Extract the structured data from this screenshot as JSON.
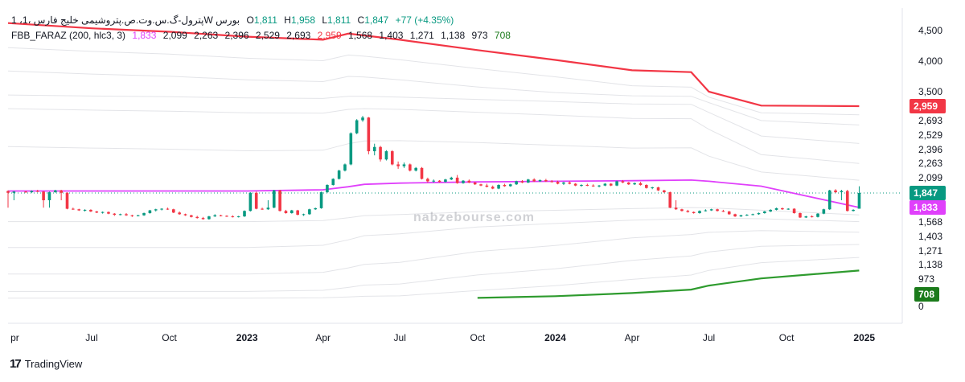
{
  "legend": {
    "title": "پترول-گ.س.وت.ص.پتروشیمی خلیج فارس، 1W، بورس",
    "title_display": "1 ،پترول-گ.س.وت.ص.پتروشیمی خلیج فارس ،1W بورس",
    "o_label": "O",
    "o": "1,811",
    "h_label": "H",
    "h": "1,958",
    "l_label": "L",
    "l": "1,811",
    "c_label": "C",
    "c": "1,847",
    "change": "+77 (+4.35%)",
    "indicator": "FBB_FARAZ (200, hlc3, 3)",
    "ind_values": [
      "1,833",
      "2,099",
      "2,263",
      "2,396",
      "2,529",
      "2,693",
      "2,959",
      "1,568",
      "1,403",
      "1,271",
      "1,138",
      "973",
      "708"
    ]
  },
  "branding": {
    "logo": "TradingView",
    "watermark": "nabzebourse.com"
  },
  "chart_data": {
    "type": "candlestick",
    "interval": "1W",
    "x_axis": {
      "tick_labels": [
        "pr",
        "Jul",
        "Oct",
        "2023",
        "Apr",
        "Jul",
        "Oct",
        "2024",
        "Apr",
        "Jul",
        "Oct",
        "2025"
      ],
      "tick_dates": [
        "2022-04-01",
        "2022-07-01",
        "2022-10-01",
        "2023-01-01",
        "2023-04-01",
        "2023-07-01",
        "2023-10-01",
        "2024-01-01",
        "2024-04-01",
        "2024-07-01",
        "2024-10-01",
        "2025-01-01"
      ],
      "range": [
        "2022-03-24",
        "2025-02-15"
      ]
    },
    "y_axis": {
      "ticks": [
        0,
        4000,
        4500
      ],
      "tick_labels": [
        "0",
        "4,000",
        "4,500"
      ],
      "scale": "log-compressed"
    },
    "price_labels": [
      {
        "value": 2959,
        "text": "2,959",
        "style": "red-box"
      },
      {
        "value": 2693,
        "text": "2,693",
        "style": "plain"
      },
      {
        "value": 2529,
        "text": "2,529",
        "style": "plain"
      },
      {
        "value": 2396,
        "text": "2,396",
        "style": "plain"
      },
      {
        "value": 2263,
        "text": "2,263",
        "style": "plain"
      },
      {
        "value": 2099,
        "text": "2,099",
        "style": "plain"
      },
      {
        "value": 1847,
        "text": "1,847",
        "style": "green-box"
      },
      {
        "value": 1833,
        "text": "1,833",
        "style": "magenta-box"
      },
      {
        "value": 1568,
        "text": "1,568",
        "style": "plain"
      },
      {
        "value": 1403,
        "text": "1,403",
        "style": "plain"
      },
      {
        "value": 1271,
        "text": "1,271",
        "style": "plain"
      },
      {
        "value": 1138,
        "text": "1,138",
        "style": "plain"
      },
      {
        "value": 973,
        "text": "973",
        "style": "plain"
      },
      {
        "value": 708,
        "text": "708",
        "style": "dark-green-box"
      },
      {
        "value": 3500,
        "text": "3,500",
        "style": "plain"
      }
    ],
    "colors": {
      "up": "#089981",
      "down": "#f23645",
      "mid_band": "#e040fb",
      "upper_band": "#f23645",
      "lower_band": "#2e9b2e",
      "inner_bands": "#e3e4e8"
    },
    "candles": [
      [
        "2022-03-24",
        1880,
        1890,
        1830,
        1850
      ],
      [
        "2022-03-31",
        1850,
        1880,
        1840,
        1870
      ],
      [
        "2022-04-14",
        1870,
        1880,
        1850,
        1860
      ],
      [
        "2022-04-21",
        1860,
        1890,
        1850,
        1880
      ],
      [
        "2022-04-28",
        1880,
        1900,
        1860,
        1870
      ],
      [
        "2022-05-05",
        1870,
        1880,
        1830,
        1840
      ],
      [
        "2022-05-12",
        1840,
        1870,
        1830,
        1860
      ],
      [
        "2022-05-19",
        1860,
        1900,
        1850,
        1890
      ],
      [
        "2022-05-26",
        1890,
        1900,
        1840,
        1850
      ],
      [
        "2022-06-02",
        1850,
        1860,
        1800,
        1810
      ],
      [
        "2022-06-09",
        1810,
        1830,
        1790,
        1800
      ],
      [
        "2022-06-16",
        1800,
        1810,
        1770,
        1780
      ],
      [
        "2022-06-23",
        1780,
        1800,
        1760,
        1790
      ],
      [
        "2022-06-30",
        1790,
        1800,
        1750,
        1760
      ],
      [
        "2022-07-07",
        1760,
        1770,
        1730,
        1740
      ],
      [
        "2022-07-14",
        1740,
        1760,
        1720,
        1750
      ],
      [
        "2022-07-21",
        1750,
        1760,
        1710,
        1720
      ],
      [
        "2022-07-28",
        1720,
        1730,
        1680,
        1700
      ],
      [
        "2022-08-04",
        1700,
        1720,
        1690,
        1710
      ],
      [
        "2022-08-11",
        1710,
        1730,
        1680,
        1690
      ],
      [
        "2022-08-18",
        1690,
        1700,
        1660,
        1680
      ],
      [
        "2022-08-25",
        1680,
        1700,
        1670,
        1690
      ],
      [
        "2022-09-01",
        1690,
        1740,
        1680,
        1730
      ],
      [
        "2022-09-08",
        1730,
        1790,
        1720,
        1780
      ],
      [
        "2022-09-15",
        1780,
        1810,
        1760,
        1800
      ],
      [
        "2022-09-22",
        1800,
        1820,
        1780,
        1810
      ],
      [
        "2022-09-29",
        1810,
        1830,
        1790,
        1800
      ],
      [
        "2022-10-06",
        1800,
        1810,
        1730,
        1740
      ],
      [
        "2022-10-13",
        1740,
        1760,
        1700,
        1710
      ],
      [
        "2022-10-20",
        1710,
        1720,
        1680,
        1690
      ],
      [
        "2022-10-27",
        1690,
        1700,
        1650,
        1660
      ],
      [
        "2022-11-03",
        1660,
        1680,
        1630,
        1640
      ],
      [
        "2022-11-10",
        1640,
        1660,
        1610,
        1620
      ],
      [
        "2022-11-17",
        1620,
        1680,
        1610,
        1670
      ],
      [
        "2022-11-24",
        1670,
        1710,
        1660,
        1690
      ],
      [
        "2022-12-01",
        1690,
        1700,
        1670,
        1680
      ],
      [
        "2022-12-08",
        1680,
        1690,
        1660,
        1670
      ],
      [
        "2022-12-15",
        1670,
        1690,
        1650,
        1660
      ],
      [
        "2022-12-22",
        1660,
        1680,
        1650,
        1670
      ],
      [
        "2022-12-29",
        1670,
        1780,
        1660,
        1770
      ],
      [
        "2023-01-05",
        1770,
        1860,
        1760,
        1850
      ],
      [
        "2023-01-12",
        1850,
        1870,
        1800,
        1810
      ],
      [
        "2023-01-19",
        1810,
        1830,
        1790,
        1800
      ],
      [
        "2023-01-26",
        1800,
        1840,
        1790,
        1830
      ],
      [
        "2023-02-02",
        1830,
        1900,
        1820,
        1890
      ],
      [
        "2023-02-09",
        1890,
        1900,
        1760,
        1770
      ],
      [
        "2023-02-16",
        1770,
        1790,
        1720,
        1730
      ],
      [
        "2023-02-23",
        1730,
        1790,
        1720,
        1780
      ],
      [
        "2023-03-02",
        1780,
        1790,
        1690,
        1700
      ],
      [
        "2023-03-09",
        1700,
        1720,
        1680,
        1710
      ],
      [
        "2023-03-16",
        1710,
        1810,
        1700,
        1800
      ],
      [
        "2023-03-23",
        1800,
        1830,
        1790,
        1820
      ],
      [
        "2023-03-30",
        1820,
        1870,
        1810,
        1860
      ],
      [
        "2023-04-06",
        1860,
        1990,
        1850,
        1980
      ],
      [
        "2023-04-13",
        1980,
        2090,
        1970,
        2080
      ],
      [
        "2023-04-20",
        2080,
        2190,
        2070,
        2180
      ],
      [
        "2023-04-27",
        2180,
        2260,
        2170,
        2250
      ],
      [
        "2023-05-04",
        2250,
        2560,
        2240,
        2550
      ],
      [
        "2023-05-11",
        2550,
        2720,
        2540,
        2700
      ],
      [
        "2023-05-18",
        2700,
        2780,
        2680,
        2750
      ],
      [
        "2023-05-25",
        2750,
        2760,
        2350,
        2380
      ],
      [
        "2023-06-01",
        2380,
        2450,
        2340,
        2420
      ],
      [
        "2023-06-08",
        2420,
        2430,
        2280,
        2300
      ],
      [
        "2023-06-15",
        2300,
        2390,
        2290,
        2380
      ],
      [
        "2023-06-22",
        2380,
        2390,
        2240,
        2250
      ],
      [
        "2023-06-29",
        2250,
        2280,
        2200,
        2230
      ],
      [
        "2023-07-06",
        2230,
        2270,
        2210,
        2250
      ],
      [
        "2023-07-13",
        2250,
        2260,
        2170,
        2180
      ],
      [
        "2023-07-20",
        2180,
        2220,
        2170,
        2210
      ],
      [
        "2023-07-27",
        2210,
        2220,
        2070,
        2080
      ],
      [
        "2023-08-03",
        2080,
        2100,
        2020,
        2040
      ],
      [
        "2023-08-10",
        2040,
        2070,
        2020,
        2050
      ],
      [
        "2023-08-17",
        2050,
        2060,
        2020,
        2030
      ],
      [
        "2023-08-24",
        2030,
        2080,
        2020,
        2070
      ],
      [
        "2023-08-31",
        2070,
        2110,
        2060,
        2100
      ],
      [
        "2023-09-07",
        2100,
        2130,
        2000,
        2010
      ],
      [
        "2023-09-14",
        2010,
        2060,
        2000,
        2050
      ],
      [
        "2023-09-21",
        2050,
        2070,
        2010,
        2020
      ],
      [
        "2023-09-28",
        2020,
        2030,
        1980,
        1990
      ],
      [
        "2023-10-05",
        1990,
        2000,
        1960,
        1970
      ],
      [
        "2023-10-12",
        1970,
        2000,
        1940,
        1950
      ],
      [
        "2023-10-19",
        1950,
        1970,
        1910,
        1920
      ],
      [
        "2023-10-26",
        1920,
        1990,
        1910,
        1980
      ],
      [
        "2023-11-02",
        1980,
        2000,
        1950,
        1960
      ],
      [
        "2023-11-09",
        1960,
        2000,
        1950,
        1990
      ],
      [
        "2023-11-16",
        1990,
        2050,
        1980,
        2040
      ],
      [
        "2023-11-23",
        2040,
        2060,
        2010,
        2020
      ],
      [
        "2023-11-30",
        2020,
        2080,
        2010,
        2070
      ],
      [
        "2023-12-07",
        2070,
        2090,
        2030,
        2040
      ],
      [
        "2023-12-14",
        2040,
        2070,
        2030,
        2060
      ],
      [
        "2023-12-21",
        2060,
        2080,
        2030,
        2040
      ],
      [
        "2023-12-28",
        2040,
        2060,
        2020,
        2030
      ],
      [
        "2024-01-04",
        2030,
        2050,
        1990,
        2000
      ],
      [
        "2024-01-11",
        2000,
        2030,
        1980,
        2020
      ],
      [
        "2024-01-18",
        2020,
        2040,
        1990,
        2000
      ],
      [
        "2024-01-25",
        2000,
        2010,
        1960,
        1970
      ],
      [
        "2024-02-01",
        1970,
        1990,
        1950,
        1980
      ],
      [
        "2024-02-08",
        1980,
        2000,
        1960,
        1970
      ],
      [
        "2024-02-15",
        1970,
        1990,
        1950,
        1960
      ],
      [
        "2024-02-22",
        1960,
        1980,
        1940,
        1970
      ],
      [
        "2024-02-29",
        1970,
        2010,
        1960,
        2000
      ],
      [
        "2024-03-07",
        2000,
        2010,
        1960,
        1970
      ],
      [
        "2024-03-14",
        1970,
        2050,
        1960,
        2040
      ],
      [
        "2024-03-21",
        2040,
        2060,
        2010,
        2020
      ],
      [
        "2024-03-28",
        2020,
        2030,
        1980,
        1990
      ],
      [
        "2024-04-04",
        1990,
        2020,
        1980,
        2010
      ],
      [
        "2024-04-11",
        2010,
        2030,
        1970,
        1980
      ],
      [
        "2024-04-18",
        1980,
        1990,
        1920,
        1930
      ],
      [
        "2024-04-25",
        1930,
        1950,
        1910,
        1940
      ],
      [
        "2024-05-02",
        1940,
        1950,
        1880,
        1890
      ],
      [
        "2024-05-09",
        1890,
        1900,
        1850,
        1860
      ],
      [
        "2024-05-16",
        1860,
        1870,
        1820,
        1830
      ],
      [
        "2024-05-23",
        1830,
        1840,
        1790,
        1800
      ],
      [
        "2024-05-30",
        1800,
        1810,
        1760,
        1770
      ],
      [
        "2024-06-06",
        1770,
        1790,
        1740,
        1750
      ],
      [
        "2024-06-13",
        1750,
        1760,
        1720,
        1730
      ],
      [
        "2024-06-20",
        1730,
        1780,
        1720,
        1770
      ],
      [
        "2024-06-27",
        1770,
        1800,
        1760,
        1780
      ],
      [
        "2024-07-04",
        1780,
        1810,
        1770,
        1800
      ],
      [
        "2024-07-11",
        1800,
        1810,
        1760,
        1770
      ],
      [
        "2024-07-18",
        1770,
        1790,
        1750,
        1760
      ],
      [
        "2024-07-25",
        1760,
        1770,
        1700,
        1710
      ],
      [
        "2024-08-01",
        1710,
        1720,
        1660,
        1670
      ],
      [
        "2024-08-08",
        1670,
        1700,
        1660,
        1690
      ],
      [
        "2024-08-15",
        1690,
        1710,
        1680,
        1700
      ],
      [
        "2024-08-22",
        1700,
        1720,
        1690,
        1710
      ],
      [
        "2024-08-29",
        1710,
        1740,
        1700,
        1730
      ],
      [
        "2024-09-05",
        1730,
        1770,
        1720,
        1760
      ],
      [
        "2024-09-12",
        1760,
        1800,
        1750,
        1790
      ],
      [
        "2024-09-19",
        1790,
        1830,
        1780,
        1820
      ],
      [
        "2024-09-26",
        1820,
        1830,
        1790,
        1800
      ],
      [
        "2024-10-03",
        1800,
        1820,
        1790,
        1810
      ],
      [
        "2024-10-10",
        1810,
        1820,
        1720,
        1730
      ],
      [
        "2024-10-17",
        1730,
        1740,
        1640,
        1650
      ],
      [
        "2024-10-24",
        1650,
        1680,
        1640,
        1670
      ],
      [
        "2024-10-31",
        1670,
        1690,
        1650,
        1660
      ],
      [
        "2024-11-07",
        1660,
        1730,
        1650,
        1720
      ],
      [
        "2024-11-14",
        1720,
        1810,
        1710,
        1800
      ],
      [
        "2024-11-21",
        1800,
        1900,
        1790,
        1890
      ],
      [
        "2024-11-28",
        1890,
        1910,
        1850,
        1860
      ],
      [
        "2024-12-05",
        1860,
        1900,
        1840,
        1880
      ],
      [
        "2024-12-12",
        1880,
        1900,
        1760,
        1770
      ],
      [
        "2024-12-19",
        1770,
        1800,
        1760,
        1790
      ],
      [
        "2024-12-26",
        1811,
        1958,
        1811,
        1847
      ]
    ],
    "bands": {
      "dates": [
        "2022-03-24",
        "2022-07-01",
        "2022-10-01",
        "2023-01-01",
        "2023-04-01",
        "2023-05-01",
        "2023-05-20",
        "2023-07-01",
        "2023-10-01",
        "2024-01-01",
        "2024-04-01",
        "2024-06-10",
        "2024-07-01",
        "2024-09-01",
        "2024-12-26"
      ],
      "mid": [
        1880,
        1880,
        1880,
        1880,
        1900,
        1950,
        1990,
        2010,
        2030,
        2040,
        2050,
        2060,
        2040,
        1960,
        1833
      ],
      "upper": [
        4600,
        4530,
        4480,
        4400,
        4350,
        4450,
        4420,
        4350,
        4180,
        4020,
        3850,
        3820,
        3500,
        2980,
        2959
      ],
      "lower": [
        null,
        null,
        null,
        null,
        null,
        null,
        null,
        null,
        500,
        600,
        730,
        790,
        860,
        980,
        1070
      ]
    }
  }
}
